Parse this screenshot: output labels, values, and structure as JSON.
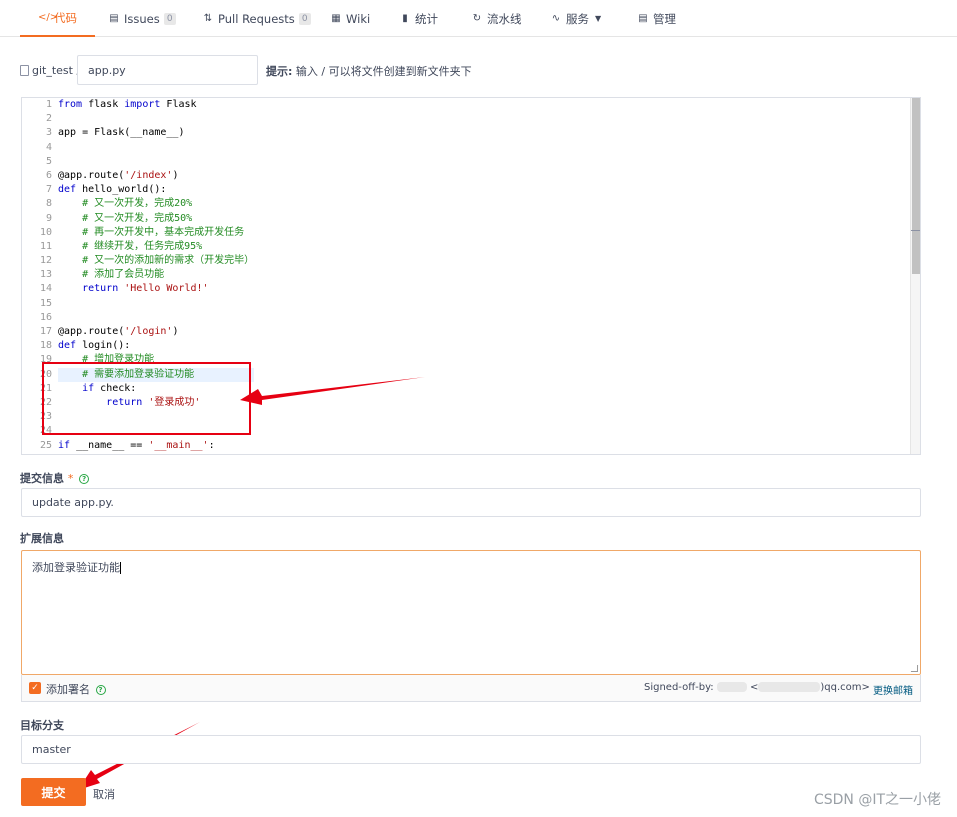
{
  "tabs": [
    {
      "label": "代码",
      "icon": "code-icon",
      "active": true
    },
    {
      "label": "Issues",
      "icon": "issues-icon",
      "count": "0"
    },
    {
      "label": "Pull Requests",
      "icon": "pull-request-icon",
      "count": "0"
    },
    {
      "label": "Wiki",
      "icon": "wiki-icon"
    },
    {
      "label": "统计",
      "icon": "stats-icon"
    },
    {
      "label": "流水线",
      "icon": "pipeline-icon"
    },
    {
      "label": "服务",
      "icon": "service-icon",
      "dropdown": true
    },
    {
      "label": "管理",
      "icon": "manage-icon"
    }
  ],
  "path": {
    "repo": "git_test /",
    "filename": "app.py",
    "hint_bold": "提示:",
    "hint_text": " 输入 / 可以将文件创建到新文件夹下"
  },
  "editor": {
    "line_numbers": [
      "1",
      "2",
      "3",
      "4",
      "5",
      "6",
      "7",
      "8",
      "9",
      "10",
      "11",
      "12",
      "13",
      "14",
      "15",
      "16",
      "17",
      "18",
      "19",
      "20",
      "21",
      "22",
      "23",
      "24",
      "25"
    ],
    "lines": [
      "from flask import Flask",
      "",
      "app = Flask(__name__)",
      "",
      "",
      "@app.route('/index')",
      "def hello_world():",
      "    # 又一次开发，完成20%",
      "    # 又一次开发，完成50%",
      "    # 再一次开发中，基本完成开发任务",
      "    # 继续开发，任务完成95%",
      "    # 又一次的添加新的需求（开发完毕）",
      "    # 添加了会员功能",
      "    return 'Hello World!'",
      "",
      "",
      "@app.route('/login')",
      "def login():",
      "    # 增加登录功能",
      "    # 需要添加登录验证功能",
      "    if check:",
      "        return '登录成功'",
      "",
      "",
      "if __name__ == '__main__':"
    ]
  },
  "form": {
    "commit_label": "提交信息",
    "commit_required": "*",
    "commit_value": "update app.py.",
    "ext_label": "扩展信息",
    "ext_value": "添加登录验证功能",
    "sign_label": "添加署名",
    "signed_off_prefix": "Signed-off-by: ",
    "signed_off_mid": "<",
    "signed_off_suffix": ")qq.com>",
    "change_email": "更换邮箱",
    "branch_label": "目标分支",
    "branch_value": "master",
    "submit": "提交",
    "cancel": "取消"
  },
  "watermark": "CSDN @IT之一小佬",
  "colors": {
    "accent": "#f36c21",
    "annotation": "#e60012"
  }
}
